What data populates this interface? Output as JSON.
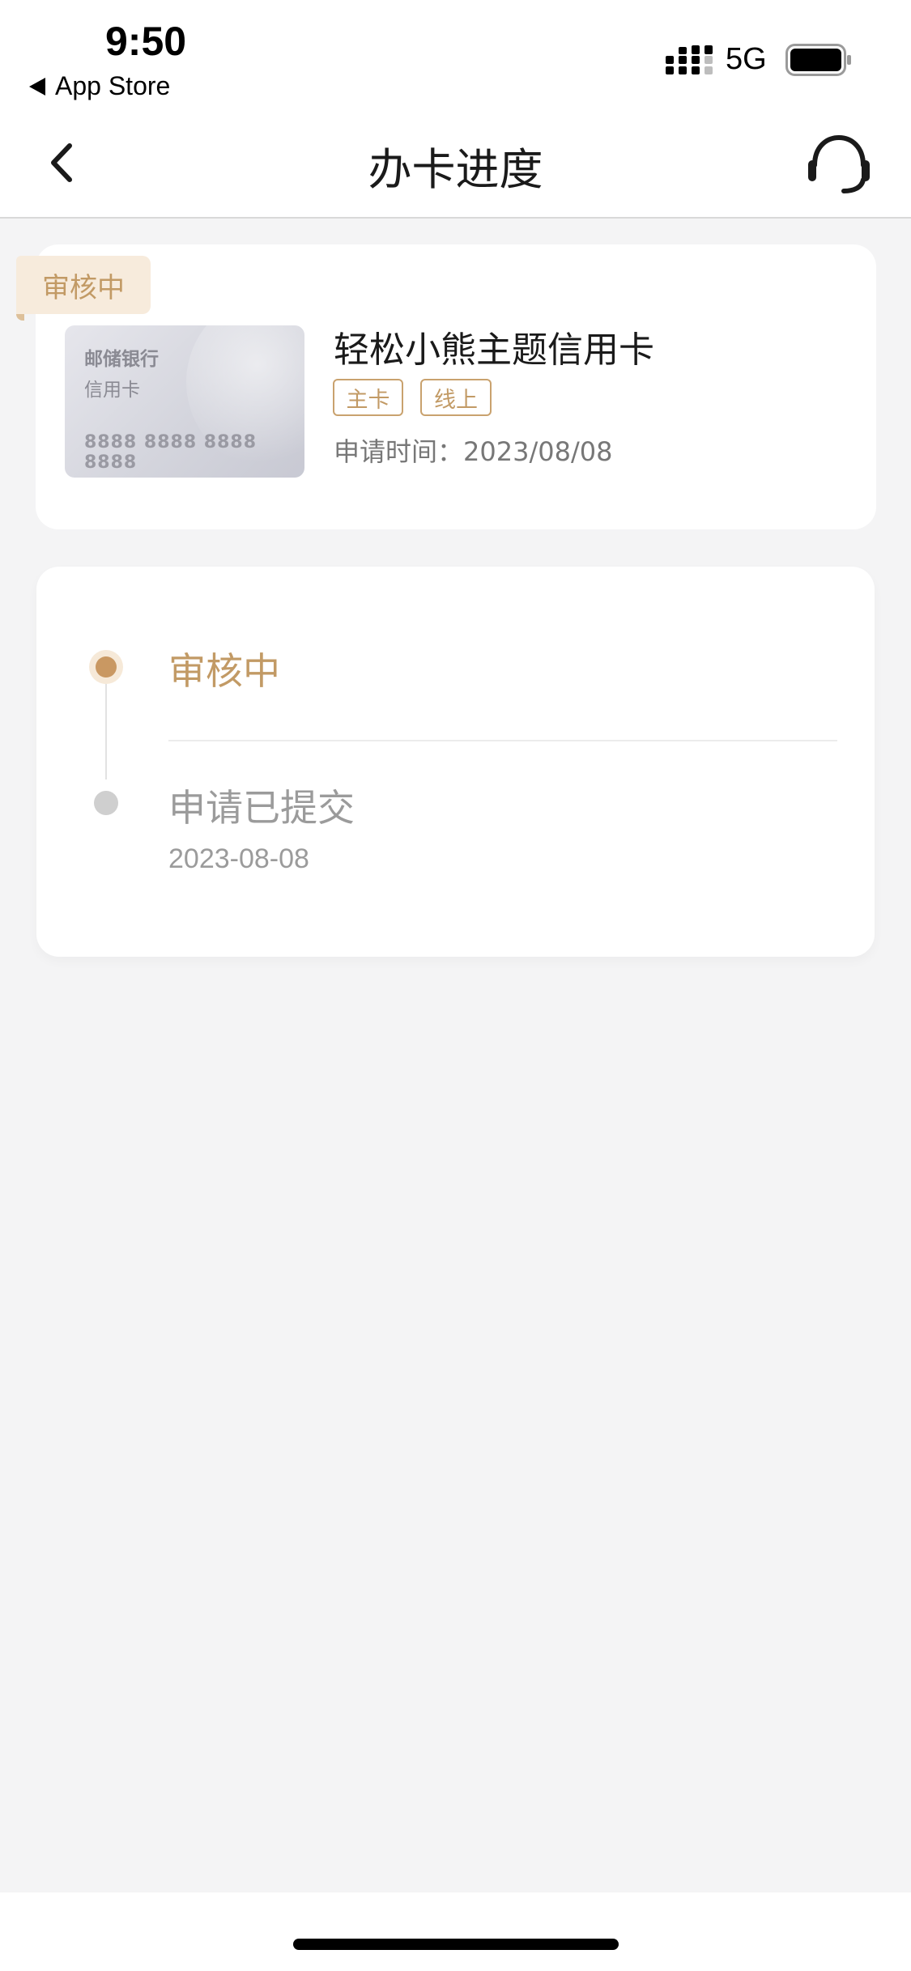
{
  "status_bar": {
    "time": "9:50",
    "back_app": "App Store",
    "network": "5G",
    "icons": [
      "signal-icon",
      "battery-icon"
    ]
  },
  "nav": {
    "title": "办卡进度",
    "back_icon": "chevron-left-icon",
    "support_icon": "headset-icon"
  },
  "application": {
    "status_tag": "审核中",
    "card_image": {
      "bank": "邮储银行",
      "type": "信用卡",
      "number": "8888 8888 8888 8888"
    },
    "card_name": "轻松小熊主题信用卡",
    "badges": [
      "主卡",
      "线上"
    ],
    "apply_time": "申请时间：2023/08/08"
  },
  "progress": {
    "steps": [
      {
        "title": "审核中",
        "date": "",
        "state": "current"
      },
      {
        "title": "申请已提交",
        "date": "2023-08-08",
        "state": "done"
      }
    ]
  },
  "colors": {
    "accent": "#c29a65",
    "tag_bg": "#f7ebdc",
    "page_bg": "#f4f4f5"
  }
}
